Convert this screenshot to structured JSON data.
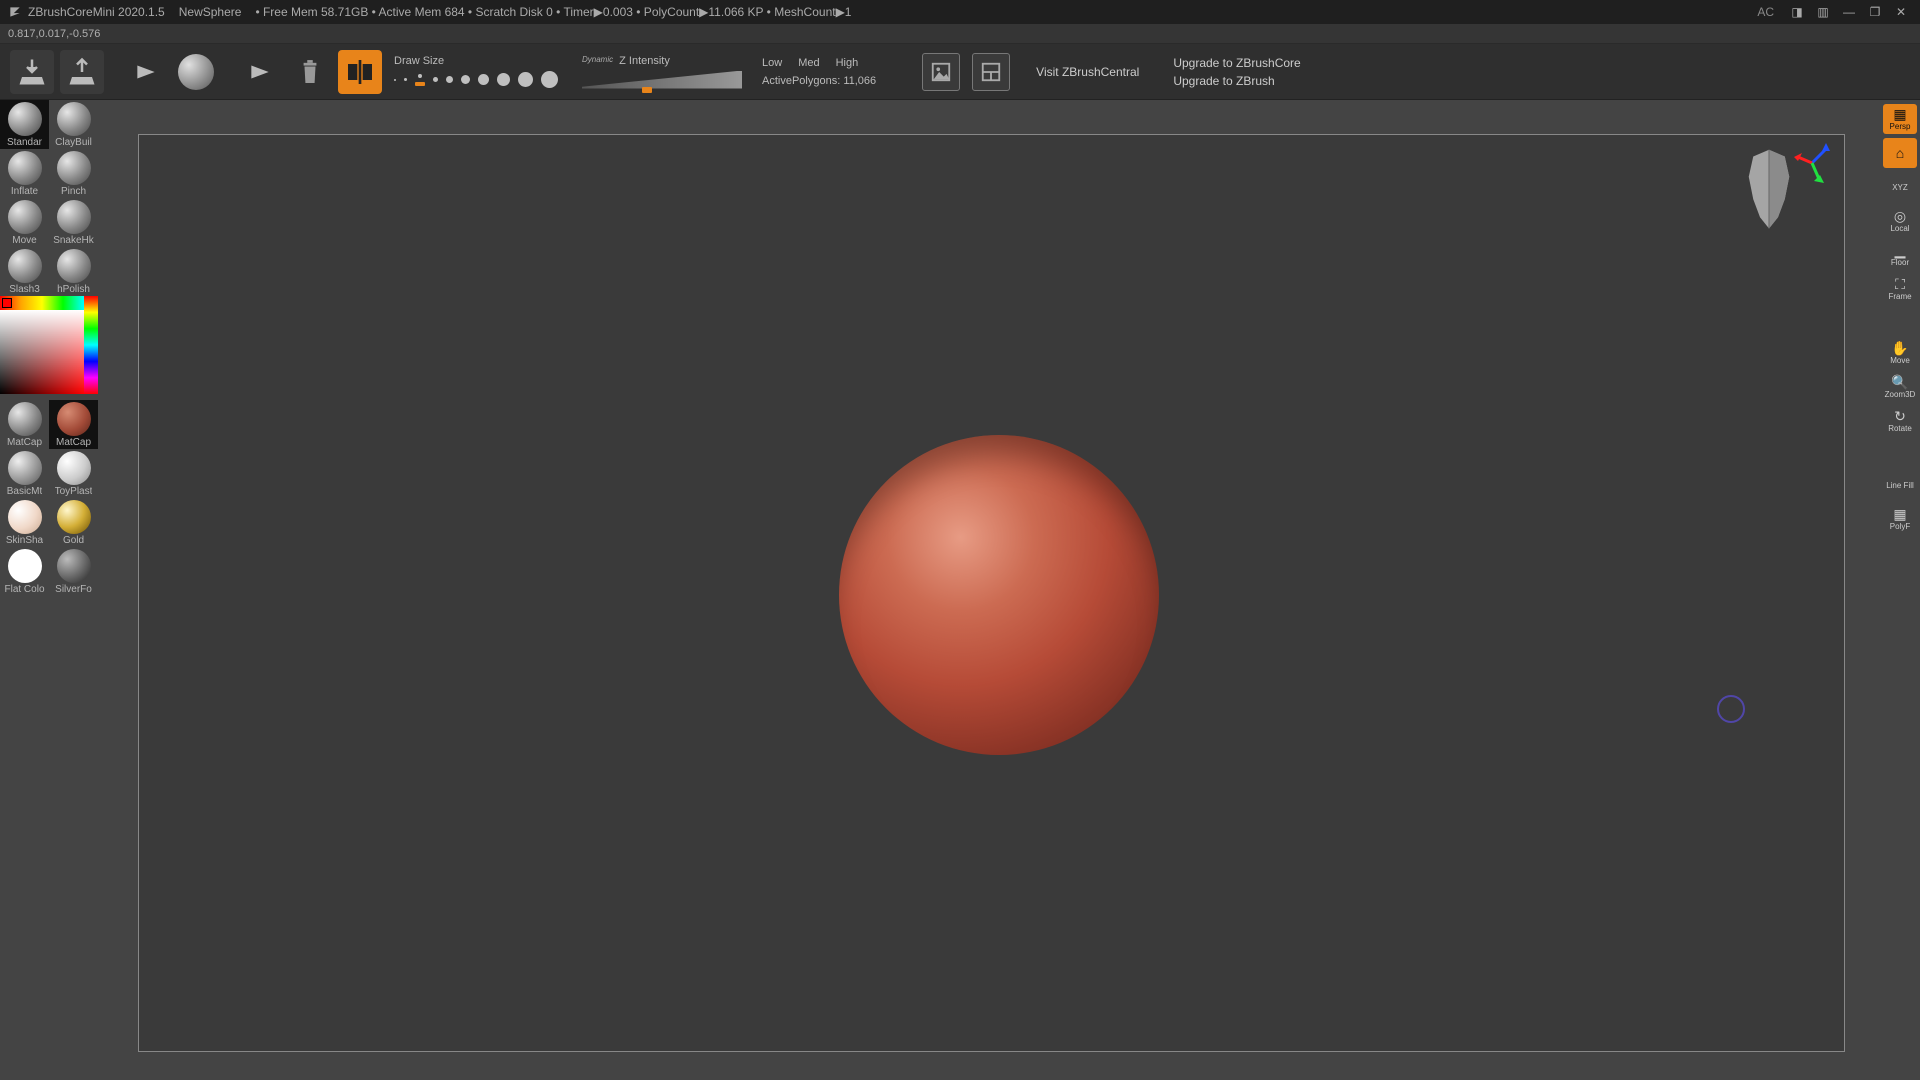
{
  "titlebar": {
    "app": "ZBrushCoreMini 2020.1.5",
    "doc": "NewSphere",
    "stats": "• Free Mem 58.71GB • Active Mem 684 • Scratch Disk 0 •  Timer▶0.003 •  PolyCount▶11.066 KP  • MeshCount▶1",
    "ac": "AC"
  },
  "status": {
    "coords": "0.817,0.017,-0.576"
  },
  "toolbar": {
    "draw_size_label": "Draw Size",
    "dynamic_label": "Dynamic",
    "z_intensity_label": "Z Intensity",
    "res": {
      "low": "Low",
      "med": "Med",
      "high": "High"
    },
    "active_poly_label": "ActivePolygons: 11,066",
    "visit_label": "Visit ZBrushCentral",
    "upgrade_core": "Upgrade to ZBrushCore",
    "upgrade_full": "Upgrade to ZBrush"
  },
  "brushes": [
    {
      "name": "Standar",
      "sel": true
    },
    {
      "name": "ClayBuil",
      "sel": false
    },
    {
      "name": "Inflate",
      "sel": false
    },
    {
      "name": "Pinch",
      "sel": false
    },
    {
      "name": "Move",
      "sel": false
    },
    {
      "name": "SnakeHk",
      "sel": false
    },
    {
      "name": "Slash3",
      "sel": false
    },
    {
      "name": "hPolish",
      "sel": false
    }
  ],
  "materials": [
    {
      "name": "MatCap",
      "sel": false,
      "grad": "radial-gradient(circle at 30% 30%,#e6e6e6,#888 55%,#444 100%)"
    },
    {
      "name": "MatCap",
      "sel": true,
      "grad": "radial-gradient(circle at 32% 30%,#d68b73,#a34b38 55%,#5a2419 100%)"
    },
    {
      "name": "BasicMt",
      "sel": false,
      "grad": "radial-gradient(circle at 30% 30%,#eee,#999 55%,#555 100%)"
    },
    {
      "name": "ToyPlast",
      "sel": false,
      "grad": "radial-gradient(circle at 30% 30%,#fff,#ccc 55%,#888 100%)"
    },
    {
      "name": "SkinSha",
      "sel": false,
      "grad": "radial-gradient(circle at 30% 30%,#fff,#f0d8c8 55%,#c9a88f 100%)"
    },
    {
      "name": "Gold",
      "sel": false,
      "grad": "radial-gradient(circle at 30% 30%,#fff7cc,#d4af37 50%,#6b4e00 100%)"
    },
    {
      "name": "Flat Colo",
      "sel": false,
      "grad": "radial-gradient(circle at 50% 50%,#fff,#fff)"
    },
    {
      "name": "SilverFo",
      "sel": false,
      "grad": "radial-gradient(circle at 30% 30%,#bbb,#666 55%,#222 100%)"
    }
  ],
  "right": {
    "persp": "Persp",
    "home": "⌂",
    "xyz": "XYZ",
    "local": "Local",
    "floor": "Floor",
    "frame": "Frame",
    "move": "Move",
    "zoom": "Zoom3D",
    "rotate": "Rotate",
    "linefill": "Line Fill",
    "polyf": "PolyF"
  }
}
